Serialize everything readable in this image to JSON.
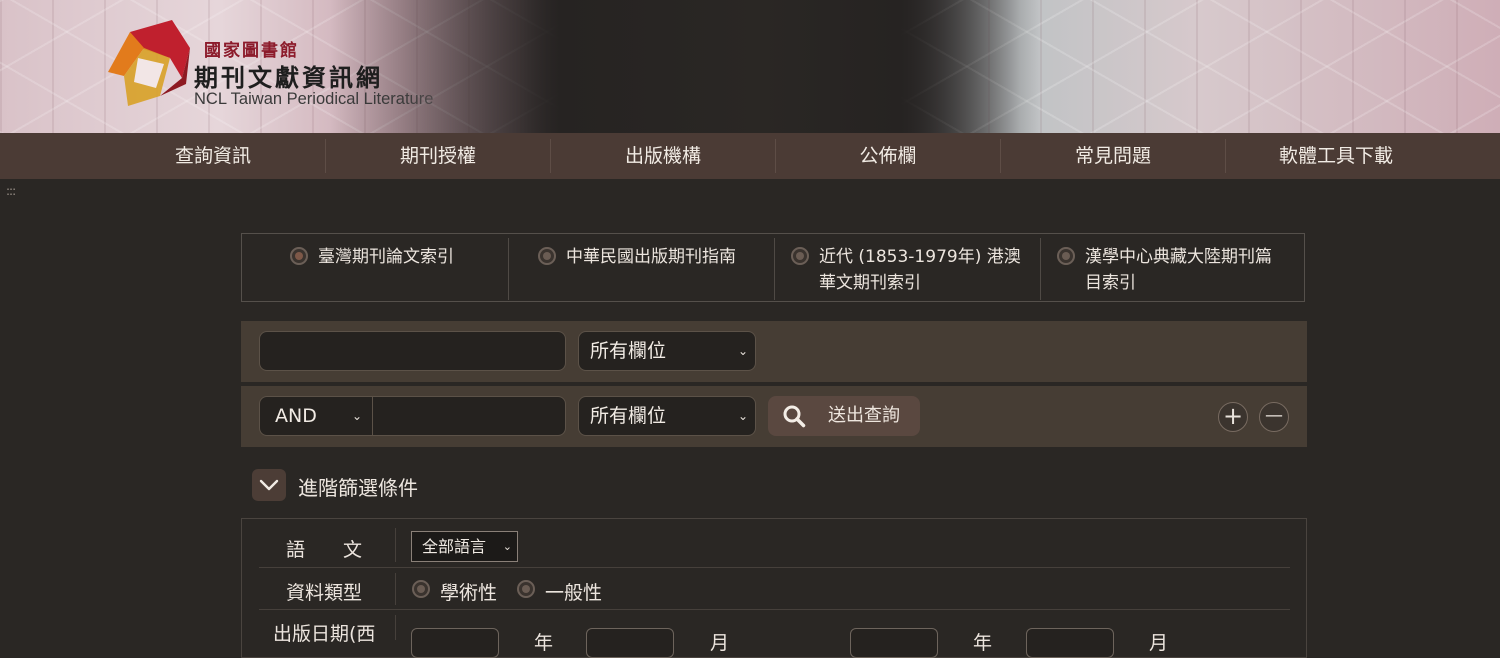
{
  "banner": {
    "org_name": "國家圖書館",
    "site_name": "期刊文獻資訊網",
    "site_name_en": "NCL Taiwan Periodical Literature"
  },
  "nav": {
    "items": [
      {
        "label": "查詢資訊"
      },
      {
        "label": "期刊授權"
      },
      {
        "label": "出版機構"
      },
      {
        "label": "公佈欄"
      },
      {
        "label": "常見問題"
      },
      {
        "label": "軟體工具下載"
      }
    ]
  },
  "grip": ":::",
  "databases": [
    {
      "line1": "臺灣期刊論文索引",
      "line2": "",
      "selected": true
    },
    {
      "line1": "中華民國出版期刊指南",
      "line2": "",
      "selected": false
    },
    {
      "line1": "近代 (1853-1979年) 港澳",
      "line2": "華文期刊索引",
      "selected": false
    },
    {
      "line1": "漢學中心典藏大陸期刊篇",
      "line2": "目索引",
      "selected": false
    }
  ],
  "search": {
    "row1": {
      "query": "",
      "field": "所有欄位"
    },
    "row2": {
      "operator": "AND",
      "query": "",
      "field": "所有欄位"
    },
    "submit_label": "送出查詢",
    "add_symbol": "+",
    "remove_symbol": "—"
  },
  "advanced": {
    "toggle_label": "進階篩選條件",
    "language": {
      "label": "語　　文",
      "value": "全部語言"
    },
    "data_type": {
      "label": "資料類型",
      "options": [
        "學術性",
        "一般性"
      ]
    },
    "pub_date": {
      "label": "出版日期(西",
      "year_unit": "年",
      "month_unit": "月"
    }
  },
  "icons": {
    "search": "search-icon",
    "chevron": "chevron-down-icon",
    "logo": "ncl-logo"
  },
  "colors": {
    "page_bg": "#2a2724",
    "nav_bg": "#4b3b35",
    "row_bg": "#463d34",
    "accent": "#7d5848"
  }
}
